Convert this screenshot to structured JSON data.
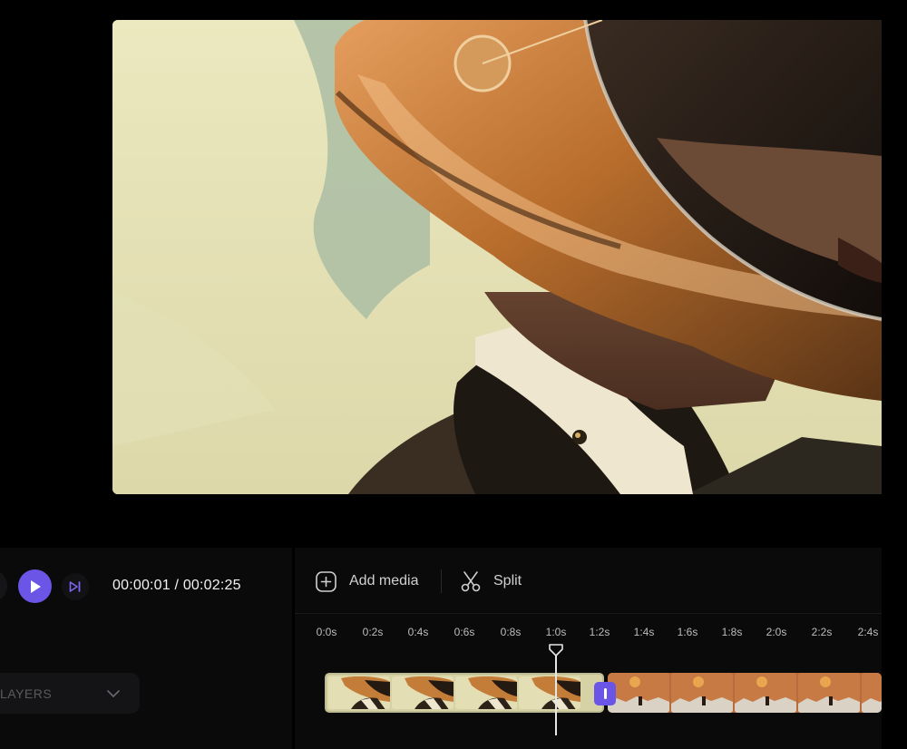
{
  "player": {
    "timecode": "00:00:01 / 00:02:25",
    "accent_color": "#6a55e6"
  },
  "toolbar": {
    "add_media_label": "Add media",
    "split_label": "Split"
  },
  "layers": {
    "label": "LAYERS"
  },
  "timeline": {
    "ticks": [
      "0:0s",
      "0:2s",
      "0:4s",
      "0:6s",
      "0:8s",
      "1:0s",
      "1:2s",
      "1:4s",
      "1:6s",
      "1:8s",
      "2:0s",
      "2:2s",
      "2:4s"
    ]
  },
  "icons": {
    "play": "play-icon",
    "next": "skip-next-icon",
    "add": "plus-square-icon",
    "split": "scissors-icon",
    "dropdown": "chevron-down-icon"
  }
}
